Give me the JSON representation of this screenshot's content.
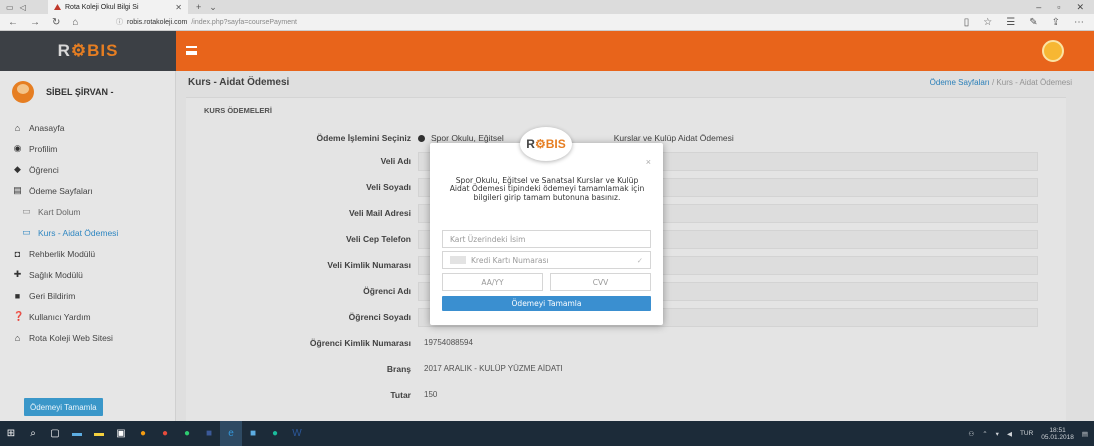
{
  "browser": {
    "tab_title": "Rota Koleji Okul Bilgi Si",
    "url_host": "robis.rotakoleji.com",
    "url_path": "/index.php?sayfa=coursePayment"
  },
  "app": {
    "logo_prefix": "R",
    "logo_mid": "⚙",
    "logo_suffix": "BIS",
    "accent": "#e8641b"
  },
  "user": {
    "name": "SİBEL ŞİRVAN -"
  },
  "sidebar": {
    "items": [
      {
        "label": "Anasayfa",
        "icon": "home-icon"
      },
      {
        "label": "Profilim",
        "icon": "user-circle-icon"
      },
      {
        "label": "Öğrenci",
        "icon": "graduation-cap-icon"
      },
      {
        "label": "Ödeme Sayfaları",
        "icon": "credit-card-icon"
      },
      {
        "label": "Kart Dolum",
        "icon": "card-icon"
      },
      {
        "label": "Kurs - Aidat Ödemesi",
        "icon": "card-icon"
      },
      {
        "label": "Rehberlik Modülü",
        "icon": "shield-icon"
      },
      {
        "label": "Sağlık Modülü",
        "icon": "health-icon"
      },
      {
        "label": "Geri Bildirim",
        "icon": "feedback-icon"
      },
      {
        "label": "Kullanıcı Yardım",
        "icon": "help-icon"
      },
      {
        "label": "Rota Koleji Web Sitesi",
        "icon": "home-icon"
      }
    ]
  },
  "page": {
    "title": "Kurs - Aidat Ödemesi",
    "breadcrumb_link": "Ödeme Sayfaları",
    "breadcrumb_sep": "/",
    "breadcrumb_current": "Kurs - Aidat Ödemesi",
    "section_title": "KURS ÖDEMELERİ"
  },
  "form": {
    "payment_type_label": "Ödeme İşlemini Seçiniz",
    "payment_type_value_start": "Spor Okulu, Eğitsel",
    "payment_type_value_end": "Kurslar ve Kulüp Aidat Ödemesi",
    "fields": [
      {
        "label": "Veli Adı",
        "value": ""
      },
      {
        "label": "Veli Soyadı",
        "value": ""
      },
      {
        "label": "Veli Mail Adresi",
        "value": ""
      },
      {
        "label": "Veli Cep Telefon",
        "value": ""
      },
      {
        "label": "Veli Kimlik Numarası",
        "value": ""
      },
      {
        "label": "Öğrenci Adı",
        "value": ""
      },
      {
        "label": "Öğrenci Soyadı",
        "value": ""
      },
      {
        "label": "Öğrenci Kimlik Numarası",
        "value": "19754088594"
      },
      {
        "label": "Branş",
        "value": "2017 ARALIK - KULÜP YÜZME AİDATI"
      },
      {
        "label": "Tutar",
        "value": "150"
      }
    ],
    "submit_label": "Ödemeyi Tamamla"
  },
  "modal": {
    "message": "Spor Okulu, Eğitsel ve Sanatsal Kurslar ve Kulüp Aidat Ödemesi tipindeki ödemeyi tamamlamak için bilgileri girip tamam butonuna basınız.",
    "close": "×",
    "card_name_placeholder": "Kart Üzerindeki İsim",
    "card_number_placeholder": "Kredi Kartı Numarası",
    "expiry_placeholder": "AA/YY",
    "cvv_placeholder": "CVV",
    "submit_label": "Ödemeyi Tamamla"
  },
  "taskbar": {
    "lang": "TUR",
    "time": "18:51",
    "date": "05.01.2018"
  }
}
